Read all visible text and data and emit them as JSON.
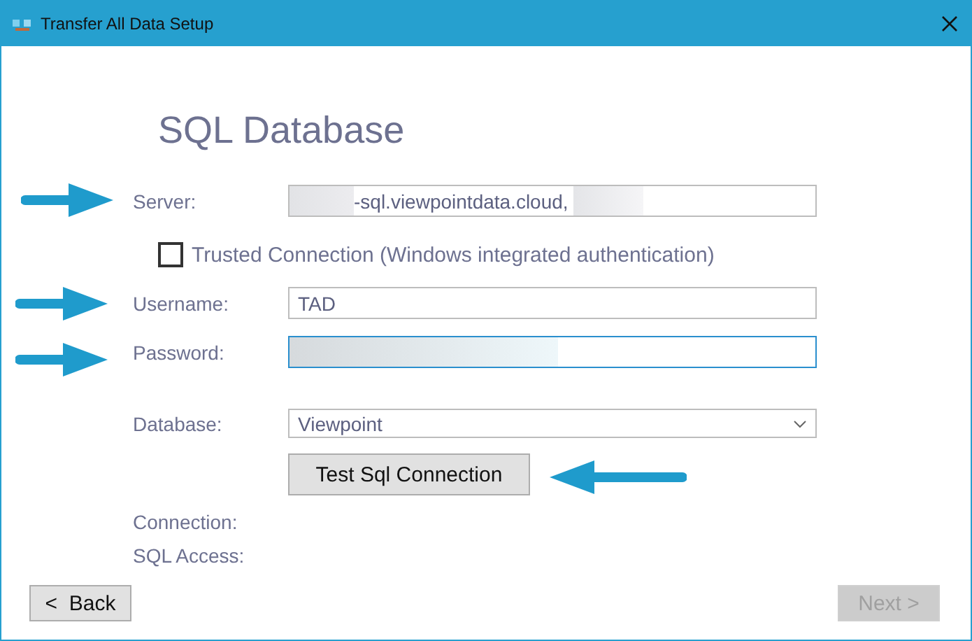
{
  "window": {
    "title": "Transfer All Data Setup"
  },
  "heading": "SQL Database",
  "server": {
    "label": "Server:",
    "value": "-sql.viewpointdata.cloud,",
    "redacted": true
  },
  "trusted_connection": {
    "label": "Trusted Connection (Windows integrated authentication)",
    "checked": false
  },
  "username": {
    "label": "Username:",
    "value": "TAD"
  },
  "password": {
    "label": "Password:",
    "redacted": true,
    "focused": true
  },
  "database": {
    "label": "Database:",
    "value": "Viewpoint"
  },
  "test_button": "Test Sql Connection",
  "status": [
    {
      "label": "Connection:"
    },
    {
      "label": "SQL Access:"
    }
  ],
  "buttons": [
    {
      "label": "<  Back",
      "disabled": false
    },
    {
      "label": "Next >",
      "disabled": true
    }
  ]
}
